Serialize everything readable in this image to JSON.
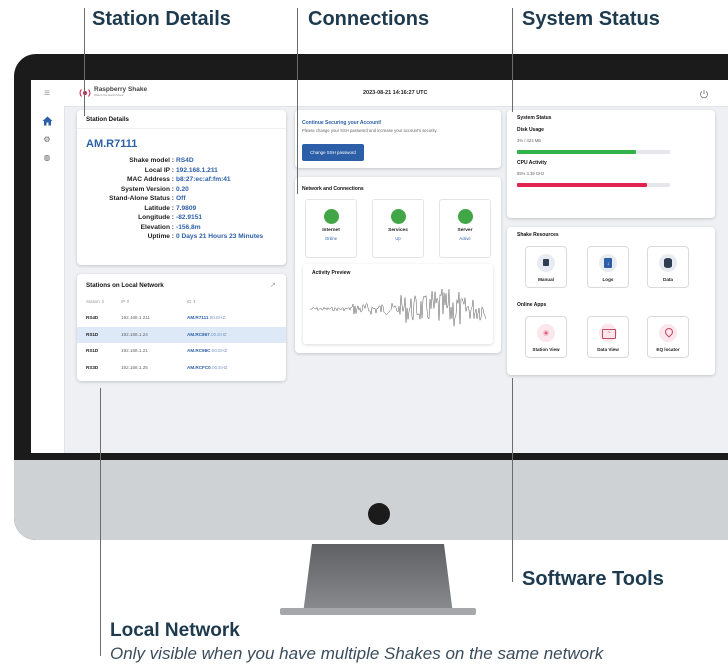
{
  "callouts": {
    "station_details": "Station Details",
    "connections": "Connections",
    "system_status": "System Status",
    "software_tools": "Software Tools",
    "local_network_title": "Local Network",
    "local_network_note": "Only visible when you have multiple Shakes on the same network"
  },
  "app": {
    "brand": "Raspberry Shake",
    "brand_tagline": "Watch the Earth Move",
    "datetime": "2023-08-21 14:16:27 UTC",
    "power_icon": "power-icon",
    "nav_icons": [
      "menu-icon",
      "home-icon",
      "settings-icon",
      "globe-icon"
    ]
  },
  "station": {
    "title": "Station Details",
    "id": "AM.R7111",
    "rows": [
      {
        "label": "Shake model :",
        "value": "RS4D"
      },
      {
        "label": "Local IP :",
        "value": "192.168.1.211"
      },
      {
        "label": "MAC Address :",
        "value": "b8:27:ec:af:fm:41"
      },
      {
        "label": "System Version :",
        "value": "0.20"
      },
      {
        "label": "Stand-Alone Status :",
        "value": "Off"
      },
      {
        "label": "Latitude :",
        "value": "7.9809"
      },
      {
        "label": "Longitude :",
        "value": "-82.9151"
      },
      {
        "label": "Elevation :",
        "value": "-156.8m"
      },
      {
        "label": "Uptime :",
        "value": "0 Days 21 Hours 23 Minutes"
      }
    ]
  },
  "local_network": {
    "title": "Stations on Local Network",
    "headers": [
      "Station ⇕",
      "IP ⇕",
      "ID ⇕"
    ],
    "rows": [
      {
        "station": "RS4D",
        "ip": "192.168.1.211",
        "id_bold": "AM.R7111",
        "id_rest": ".00.EHZ"
      },
      {
        "station": "RS1D",
        "ip": "192.168.1.24",
        "id_bold": "AM.RC867",
        "id_rest": ".00.EHZ"
      },
      {
        "station": "RS1D",
        "ip": "192.168.1.21",
        "id_bold": "AM.RC98C",
        "id_rest": ".00.EHZ"
      },
      {
        "station": "RS3D",
        "ip": "192.168.1.25",
        "id_bold": "AM.RCFC0",
        "id_rest": ".00.EHZ"
      }
    ]
  },
  "security": {
    "title": "Continue Securing your Account!",
    "message": "Please change your SSH password and increase your account's security.",
    "button": "Change SSH password"
  },
  "connections": {
    "title": "Network and Connections",
    "services": [
      {
        "name": "Internet",
        "status": "Online",
        "color": "#41a645"
      },
      {
        "name": "Services",
        "status": "Up",
        "color": "#41a645"
      },
      {
        "name": "Server",
        "status": "Active",
        "color": "#41a645"
      }
    ],
    "activity_title": "Activity Preview"
  },
  "system_status": {
    "title": "System Status",
    "disk_label": "Disk Usage",
    "disk_value": "3% / 423 MB",
    "disk_fraction": 0.03,
    "disk_color": "#2fb24a",
    "cpu_label": "CPU Activity",
    "cpu_value": "85% 3.39 GHz",
    "cpu_fraction": 0.85,
    "cpu_color": "#e0244f"
  },
  "resources": {
    "title": "Shake Resources",
    "items": [
      {
        "label": "Manual",
        "icon": "book-icon"
      },
      {
        "label": "Logs",
        "icon": "download-doc-icon"
      },
      {
        "label": "Data",
        "icon": "database-icon"
      }
    ],
    "apps_title": "Online Apps",
    "apps": [
      {
        "label": "Station View",
        "icon": "radar-icon"
      },
      {
        "label": "Data View",
        "icon": "seismogram-icon"
      },
      {
        "label": "EQ locator",
        "icon": "location-pin-icon"
      }
    ]
  }
}
